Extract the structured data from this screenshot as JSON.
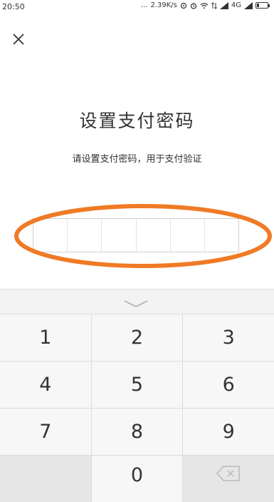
{
  "status_bar": {
    "time": "20:50",
    "dots": "...",
    "speed": "2.39K/s",
    "network": "4G"
  },
  "screen": {
    "title": "设置支付密码",
    "subtitle": "请设置支付密码，用于支付验证",
    "password_length": 6
  },
  "keyboard": {
    "rows": [
      [
        "1",
        "2",
        "3"
      ],
      [
        "4",
        "5",
        "6"
      ],
      [
        "7",
        "8",
        "9"
      ],
      [
        "",
        "0",
        "delete"
      ]
    ]
  },
  "colors": {
    "annotation_ring": "#F07A25"
  }
}
